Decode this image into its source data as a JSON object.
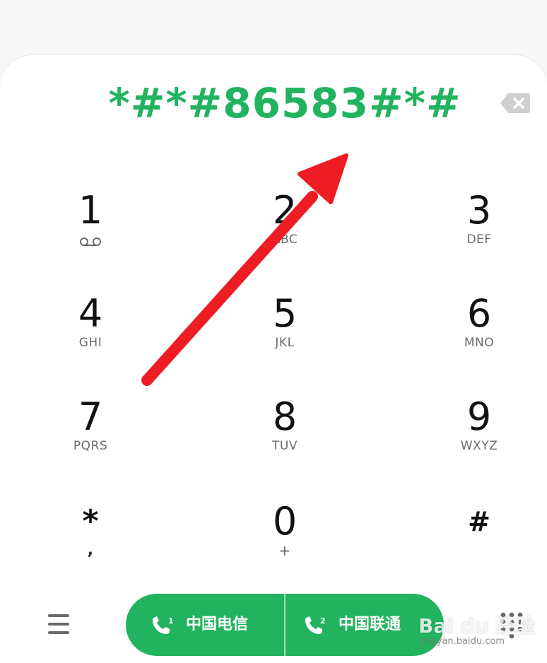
{
  "display": {
    "number": "*#*#86583#*#"
  },
  "keypad": [
    {
      "digit": "1",
      "letters": "",
      "icon": "voicemail-icon"
    },
    {
      "digit": "2",
      "letters": "ABC"
    },
    {
      "digit": "3",
      "letters": "DEF"
    },
    {
      "digit": "4",
      "letters": "GHI"
    },
    {
      "digit": "5",
      "letters": "JKL"
    },
    {
      "digit": "6",
      "letters": "MNO"
    },
    {
      "digit": "7",
      "letters": "PQRS"
    },
    {
      "digit": "8",
      "letters": "TUV"
    },
    {
      "digit": "9",
      "letters": "WXYZ"
    },
    {
      "digit": "*",
      "letters": ","
    },
    {
      "digit": "0",
      "letters": "+"
    },
    {
      "digit": "#",
      "letters": ""
    }
  ],
  "call_buttons": [
    {
      "sim": "1",
      "label": "中国电信",
      "icon": "phone-sim1-icon"
    },
    {
      "sim": "2",
      "label": "中国联通",
      "icon": "phone-sim2-icon"
    }
  ],
  "icons": {
    "backspace": "backspace-icon",
    "menu": "menu-icon",
    "dialpad": "dialpad-icon",
    "annotation": "red-arrow"
  },
  "watermark": {
    "brand": "Bai du 经验",
    "url": "jingyan.baidu.com"
  },
  "colors": {
    "accent_green": "#21b35f",
    "annotation_red": "#ee1d24",
    "digit_text": "#111111",
    "letters_text": "#6b6b6b"
  }
}
